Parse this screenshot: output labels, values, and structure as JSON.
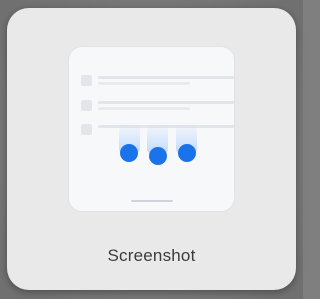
{
  "tile": {
    "label": "Screenshot",
    "icon": "screenshot-icon"
  },
  "colors": {
    "tile_background": "#e9e9ea",
    "accent": "#1a73e8",
    "label_text": "#3c3c3c"
  }
}
